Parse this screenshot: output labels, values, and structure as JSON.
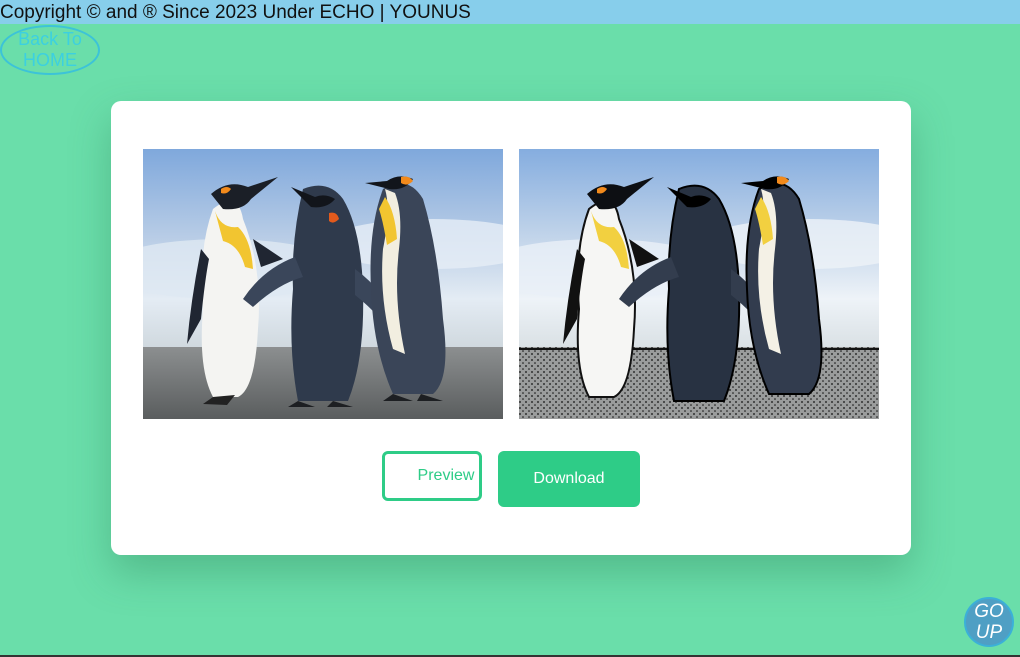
{
  "footer_bar": {
    "copyright_text": "Copyright © and ® Since 2023 Under ECHO | YOUNUS"
  },
  "nav": {
    "back_line1": "Back To",
    "back_line2": "HOME"
  },
  "images": {
    "original_icon": "penguins-photo",
    "processed_icon": "penguins-sketch-photo"
  },
  "actions": {
    "preview_label": "Preview",
    "download_label": "Download"
  },
  "scroll": {
    "go_line1": "GO",
    "go_line2": "UP"
  },
  "colors": {
    "background": "#6adeaa",
    "top_bar": "#87ceeb",
    "accent": "#2ecc87",
    "go_up": "#4f9fc4"
  }
}
